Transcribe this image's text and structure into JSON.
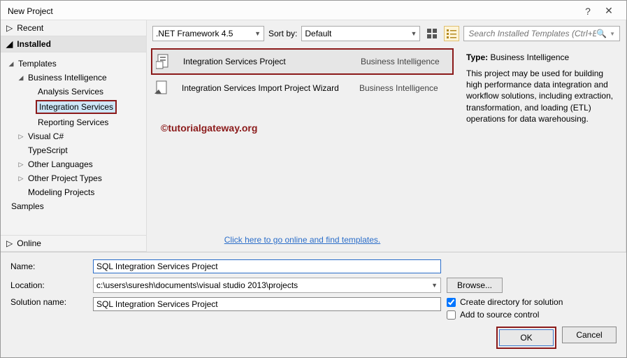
{
  "window": {
    "title": "New Project"
  },
  "sidebar": {
    "recent": "Recent",
    "installed": "Installed",
    "online": "Online",
    "templates_root": "Templates",
    "bi": "Business Intelligence",
    "bi_children": [
      "Analysis Services",
      "Integration Services",
      "Reporting Services"
    ],
    "others": [
      "Visual C#",
      "TypeScript",
      "Other Languages",
      "Other Project Types",
      "Modeling Projects"
    ],
    "samples": "Samples"
  },
  "toolbar": {
    "framework": ".NET Framework 4.5",
    "sortby_label": "Sort by:",
    "sortby_value": "Default",
    "search_placeholder": "Search Installed Templates (Ctrl+E)"
  },
  "templates": [
    {
      "name": "Integration Services Project",
      "cat": "Business Intelligence",
      "selected": true
    },
    {
      "name": "Integration Services Import Project Wizard",
      "cat": "Business Intelligence",
      "selected": false
    }
  ],
  "go_online": "Click here to go online and find templates.",
  "details": {
    "type_label": "Type:",
    "type_value": "Business Intelligence",
    "desc": "This project may be used for building high performance data integration and workflow solutions, including extraction, transformation, and loading (ETL) operations for data warehousing."
  },
  "form": {
    "name_label": "Name:",
    "name_value": "SQL Integration Services Project",
    "location_label": "Location:",
    "location_value": "c:\\users\\suresh\\documents\\visual studio 2013\\projects",
    "solution_label": "Solution name:",
    "solution_value": "SQL Integration Services Project",
    "browse": "Browse...",
    "create_dir": "Create directory for solution",
    "add_src": "Add to source control",
    "ok": "OK",
    "cancel": "Cancel"
  },
  "watermark": "©tutorialgateway.org"
}
